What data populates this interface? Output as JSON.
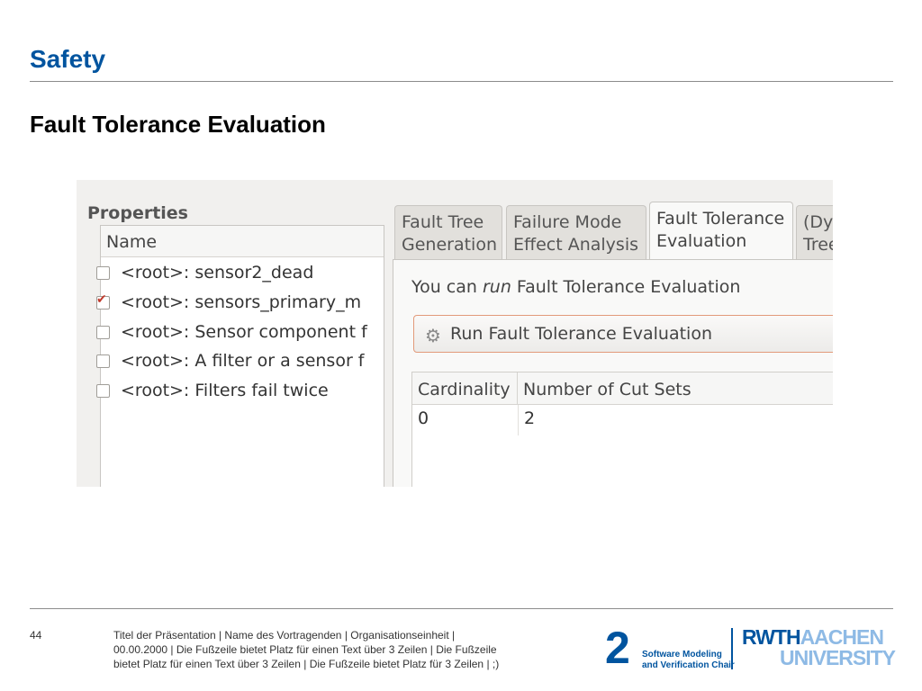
{
  "slide": {
    "title": "Safety",
    "subtitle": "Fault Tolerance Evaluation"
  },
  "properties": {
    "title": "Properties",
    "column": "Name",
    "items": [
      {
        "label": "<root>: sensor2_dead",
        "checked": false
      },
      {
        "label": "<root>: sensors_primary_m",
        "checked": true
      },
      {
        "label": "<root>: Sensor component f",
        "checked": false
      },
      {
        "label": "<root>: A filter or a sensor f",
        "checked": false
      },
      {
        "label": "<root>: Filters fail twice",
        "checked": false
      }
    ]
  },
  "tabs": [
    {
      "line1": "Fault Tree",
      "line2": "Generation",
      "active": false
    },
    {
      "line1": "Failure Mode",
      "line2": "Effect Analysis",
      "active": false
    },
    {
      "line1": "Fault Tolerance",
      "line2": "Evaluation",
      "active": true
    },
    {
      "line1": "(Dyn",
      "line2": "Tree",
      "active": false
    }
  ],
  "evaluation": {
    "note_prefix": "You can ",
    "note_emph": "run",
    "note_suffix": " Fault Tolerance Evaluation",
    "button_label": "Run Fault Tolerance Evaluation",
    "button_icon": "gears-icon",
    "table": {
      "headers": [
        "Cardinality",
        "Number of Cut Sets"
      ],
      "rows": [
        [
          "0",
          "2"
        ]
      ]
    }
  },
  "footer": {
    "page_number": "44",
    "line1": "Titel der Präsentation  |  Name des Vortragenden  |  Organisationseinheit  |",
    "line2": "00.00.2000  |  Die Fußzeile bietet Platz für einen Text über 3 Zeilen  |  Die Fußzeile",
    "line3": "bietet Platz für einen Text über 3 Zeilen  |  Die Fußzeile bietet Platz für 3 Zeilen  | ;)",
    "chair_number": "2",
    "chair_line1": "Software Modeling",
    "chair_line2": "and Verification Chair",
    "uni_part1": "RWTH",
    "uni_part2": "AACHEN",
    "uni_part3": "UNIVERSITY"
  },
  "colors": {
    "accent": "#00549f",
    "accent_light": "#8ebae5",
    "button_border": "#e29a7a",
    "checkbox_mark": "#c0392b"
  }
}
